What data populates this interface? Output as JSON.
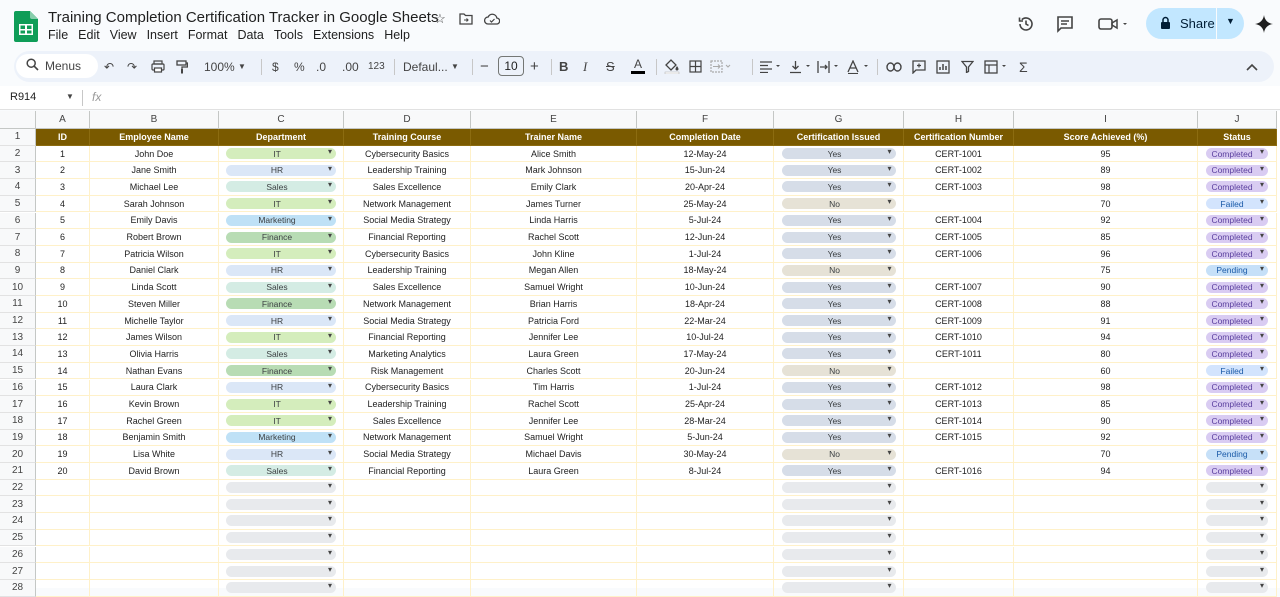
{
  "doc": {
    "title": "Training Completion Certification Tracker in Google Sheets"
  },
  "menu": [
    "File",
    "Edit",
    "View",
    "Insert",
    "Format",
    "Data",
    "Tools",
    "Extensions",
    "Help"
  ],
  "share": {
    "label": "Share"
  },
  "toolbar": {
    "search": "Menus",
    "zoom": "100%",
    "currency": "$",
    "percent": "%",
    "dec_minus": ".0",
    "dec_plus": ".00",
    "numfmt": "123",
    "font": "Defaul...",
    "font_size": "10"
  },
  "formula_bar": {
    "cell_ref": "R914",
    "fx": "fx"
  },
  "columns": [
    "A",
    "B",
    "C",
    "D",
    "E",
    "F",
    "G",
    "H",
    "I",
    "J"
  ],
  "headers": [
    "ID",
    "Employee Name",
    "Department",
    "Training Course",
    "Trainer Name",
    "Completion Date",
    "Certification Issued",
    "Certification Number",
    "Score Achieved (%)",
    "Status"
  ],
  "rows": [
    [
      "1",
      "John Doe",
      "IT",
      "Cybersecurity Basics",
      "Alice Smith",
      "12-May-24",
      "Yes",
      "CERT-1001",
      "95",
      "Completed"
    ],
    [
      "2",
      "Jane Smith",
      "HR",
      "Leadership Training",
      "Mark Johnson",
      "15-Jun-24",
      "Yes",
      "CERT-1002",
      "89",
      "Completed"
    ],
    [
      "3",
      "Michael Lee",
      "Sales",
      "Sales Excellence",
      "Emily Clark",
      "20-Apr-24",
      "Yes",
      "CERT-1003",
      "98",
      "Completed"
    ],
    [
      "4",
      "Sarah Johnson",
      "IT",
      "Network Management",
      "James Turner",
      "25-May-24",
      "No",
      "",
      "70",
      "Failed"
    ],
    [
      "5",
      "Emily Davis",
      "Marketing",
      "Social Media Strategy",
      "Linda Harris",
      "5-Jul-24",
      "Yes",
      "CERT-1004",
      "92",
      "Completed"
    ],
    [
      "6",
      "Robert Brown",
      "Finance",
      "Financial Reporting",
      "Rachel Scott",
      "12-Jun-24",
      "Yes",
      "CERT-1005",
      "85",
      "Completed"
    ],
    [
      "7",
      "Patricia Wilson",
      "IT",
      "Cybersecurity Basics",
      "John Kline",
      "1-Jul-24",
      "Yes",
      "CERT-1006",
      "96",
      "Completed"
    ],
    [
      "8",
      "Daniel Clark",
      "HR",
      "Leadership Training",
      "Megan Allen",
      "18-May-24",
      "No",
      "",
      "75",
      "Pending"
    ],
    [
      "9",
      "Linda Scott",
      "Sales",
      "Sales Excellence",
      "Samuel Wright",
      "10-Jun-24",
      "Yes",
      "CERT-1007",
      "90",
      "Completed"
    ],
    [
      "10",
      "Steven Miller",
      "Finance",
      "Network Management",
      "Brian Harris",
      "18-Apr-24",
      "Yes",
      "CERT-1008",
      "88",
      "Completed"
    ],
    [
      "11",
      "Michelle Taylor",
      "HR",
      "Social Media Strategy",
      "Patricia Ford",
      "22-Mar-24",
      "Yes",
      "CERT-1009",
      "91",
      "Completed"
    ],
    [
      "12",
      "James Wilson",
      "IT",
      "Financial Reporting",
      "Jennifer Lee",
      "10-Jul-24",
      "Yes",
      "CERT-1010",
      "94",
      "Completed"
    ],
    [
      "13",
      "Olivia Harris",
      "Sales",
      "Marketing Analytics",
      "Laura Green",
      "17-May-24",
      "Yes",
      "CERT-1011",
      "80",
      "Completed"
    ],
    [
      "14",
      "Nathan Evans",
      "Finance",
      "Risk Management",
      "Charles Scott",
      "20-Jun-24",
      "No",
      "",
      "60",
      "Failed"
    ],
    [
      "15",
      "Laura Clark",
      "HR",
      "Cybersecurity Basics",
      "Tim Harris",
      "1-Jul-24",
      "Yes",
      "CERT-1012",
      "98",
      "Completed"
    ],
    [
      "16",
      "Kevin Brown",
      "IT",
      "Leadership Training",
      "Rachel Scott",
      "25-Apr-24",
      "Yes",
      "CERT-1013",
      "85",
      "Completed"
    ],
    [
      "17",
      "Rachel Green",
      "IT",
      "Sales Excellence",
      "Jennifer Lee",
      "28-Mar-24",
      "Yes",
      "CERT-1014",
      "90",
      "Completed"
    ],
    [
      "18",
      "Benjamin Smith",
      "Marketing",
      "Network Management",
      "Samuel Wright",
      "5-Jun-24",
      "Yes",
      "CERT-1015",
      "92",
      "Completed"
    ],
    [
      "19",
      "Lisa White",
      "HR",
      "Social Media Strategy",
      "Michael Davis",
      "30-May-24",
      "No",
      "",
      "70",
      "Pending"
    ],
    [
      "20",
      "David Brown",
      "Sales",
      "Financial Reporting",
      "Laura Green",
      "8-Jul-24",
      "Yes",
      "CERT-1016",
      "94",
      "Completed"
    ]
  ],
  "row_numbers": [
    "1",
    "2",
    "3",
    "4",
    "5",
    "6",
    "7",
    "8",
    "9",
    "10",
    "11",
    "12",
    "13",
    "14",
    "15",
    "16",
    "17",
    "18",
    "19",
    "20",
    "21",
    "22",
    "23",
    "24",
    "25",
    "26",
    "27",
    "28"
  ],
  "chip_colors": {
    "IT": "#d4edbc",
    "HR": "#dbe7f7",
    "Sales": "#d4ece4",
    "Marketing": "#bfe1f6",
    "Finance": "#b8dcb4",
    "Yes": "#d6dde8",
    "No": "#e6e2d6",
    "Completed": "#d9ccf2",
    "Failed": "#d3e4fd",
    "Pending": "#c6e0f8",
    "empty": "#e8eaed"
  },
  "accent": {
    "header_bg": "#7a5a00",
    "share_bg": "#c2e7ff"
  }
}
